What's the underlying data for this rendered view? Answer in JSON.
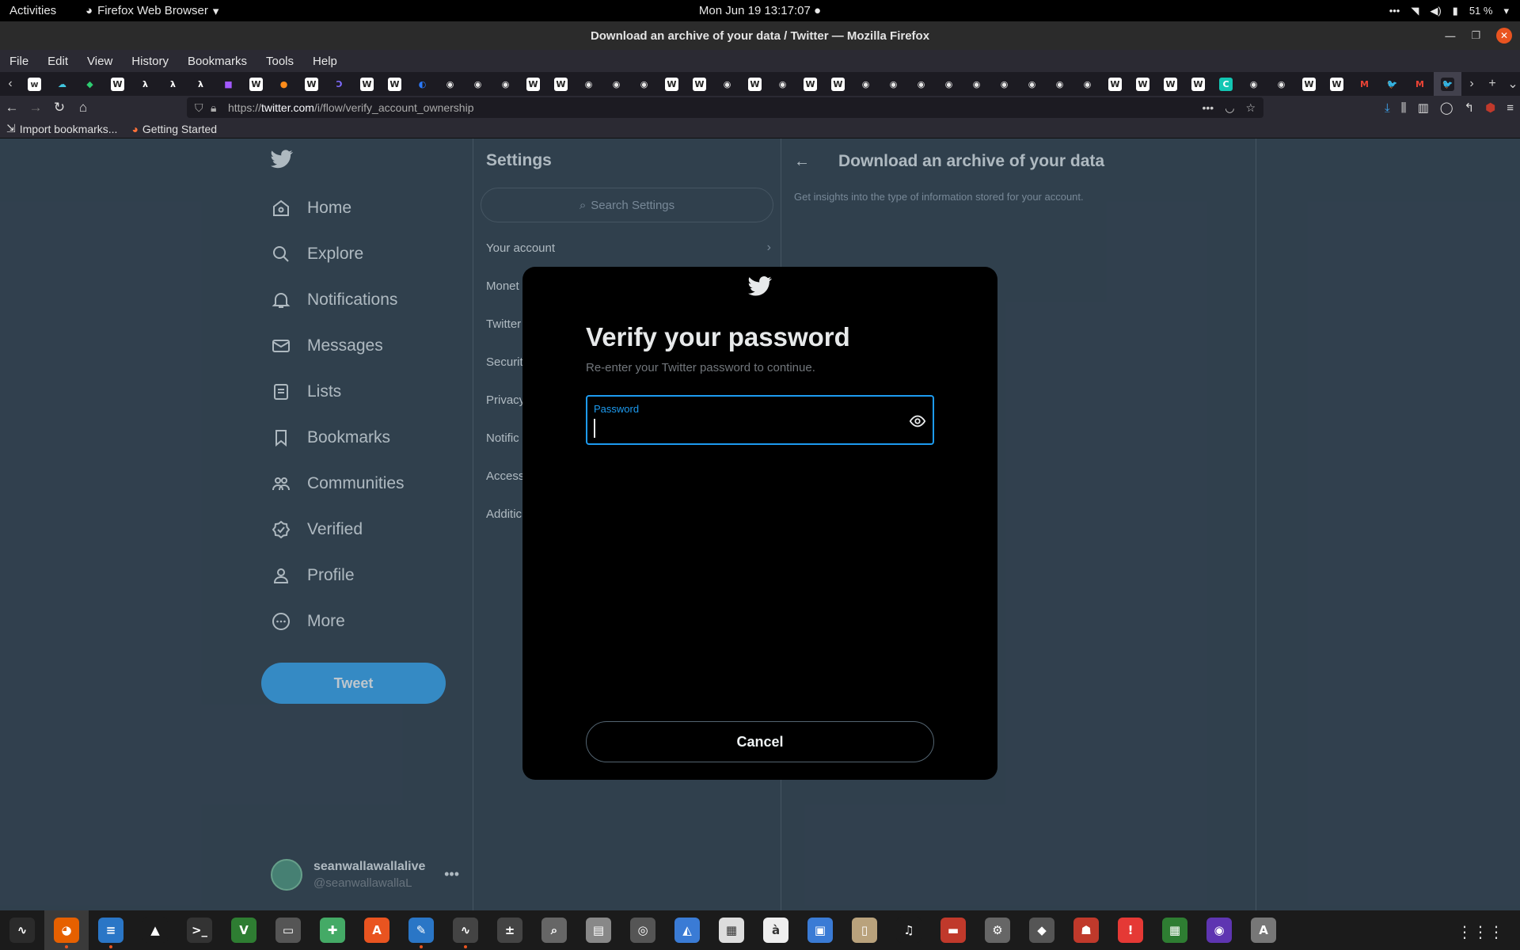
{
  "topbar": {
    "activities": "Activities",
    "app_name": "Firefox Web Browser",
    "clock": "Mon Jun 19  13:17:07",
    "battery": "51 %"
  },
  "window": {
    "title": "Download an archive of your data / Twitter — Mozilla Firefox"
  },
  "menubar": [
    "File",
    "Edit",
    "View",
    "History",
    "Bookmarks",
    "Tools",
    "Help"
  ],
  "tabs": [
    {
      "icon": "twitter-icon",
      "glyph": "w",
      "bg": "#ffffff",
      "fg": "#333"
    },
    {
      "icon": "cloud-icon",
      "glyph": "☁",
      "bg": "#1c1b22",
      "fg": "#41c7e0"
    },
    {
      "icon": "shield-icon",
      "glyph": "◆",
      "bg": "#1c1b22",
      "fg": "#2ecc71"
    },
    {
      "icon": "wikipedia-icon",
      "glyph": "W",
      "bg": "#ffffff",
      "fg": "#222"
    },
    {
      "icon": "lambda-icon",
      "glyph": "λ",
      "bg": "#1c1b22",
      "fg": "#ffffff"
    },
    {
      "icon": "lambda-icon",
      "glyph": "λ",
      "bg": "#1c1b22",
      "fg": "#ffffff"
    },
    {
      "icon": "lambda-icon",
      "glyph": "λ",
      "bg": "#1c1b22",
      "fg": "#ffffff"
    },
    {
      "icon": "folder-icon",
      "glyph": "■",
      "bg": "#1c1b22",
      "fg": "#a259ff"
    },
    {
      "icon": "wikipedia-icon",
      "glyph": "W",
      "bg": "#ffffff",
      "fg": "#222"
    },
    {
      "icon": "orange-icon",
      "glyph": "●",
      "bg": "#1c1b22",
      "fg": "#ff8c1a"
    },
    {
      "icon": "wikipedia-icon",
      "glyph": "W",
      "bg": "#ffffff",
      "fg": "#222"
    },
    {
      "icon": "curve-icon",
      "glyph": "Ↄ",
      "bg": "#1c1b22",
      "fg": "#7f6bff"
    },
    {
      "icon": "wikipedia-icon",
      "glyph": "W",
      "bg": "#ffffff",
      "fg": "#222"
    },
    {
      "icon": "wikipedia-icon",
      "glyph": "W",
      "bg": "#ffffff",
      "fg": "#222"
    },
    {
      "icon": "drop-icon",
      "glyph": "◐",
      "bg": "#1c1b22",
      "fg": "#2b7bff"
    },
    {
      "icon": "github-icon",
      "glyph": "◉",
      "bg": "#1c1b22",
      "fg": "#e8e8e8"
    },
    {
      "icon": "github-icon",
      "glyph": "◉",
      "bg": "#1c1b22",
      "fg": "#e8e8e8"
    },
    {
      "icon": "github-icon",
      "glyph": "◉",
      "bg": "#1c1b22",
      "fg": "#e8e8e8"
    },
    {
      "icon": "wikipedia-icon",
      "glyph": "W",
      "bg": "#ffffff",
      "fg": "#222"
    },
    {
      "icon": "wikipedia-icon",
      "glyph": "W",
      "bg": "#ffffff",
      "fg": "#222"
    },
    {
      "icon": "github-icon",
      "glyph": "◉",
      "bg": "#1c1b22",
      "fg": "#e8e8e8"
    },
    {
      "icon": "github-icon",
      "glyph": "◉",
      "bg": "#1c1b22",
      "fg": "#e8e8e8"
    },
    {
      "icon": "github-icon",
      "glyph": "◉",
      "bg": "#1c1b22",
      "fg": "#e8e8e8"
    },
    {
      "icon": "wikipedia-icon",
      "glyph": "W",
      "bg": "#ffffff",
      "fg": "#222"
    },
    {
      "icon": "wikipedia-icon",
      "glyph": "W",
      "bg": "#ffffff",
      "fg": "#222"
    },
    {
      "icon": "github-icon",
      "glyph": "◉",
      "bg": "#1c1b22",
      "fg": "#e8e8e8"
    },
    {
      "icon": "wikipedia-icon",
      "glyph": "W",
      "bg": "#ffffff",
      "fg": "#222"
    },
    {
      "icon": "github-icon",
      "glyph": "◉",
      "bg": "#1c1b22",
      "fg": "#e8e8e8"
    },
    {
      "icon": "wikipedia-icon",
      "glyph": "W",
      "bg": "#ffffff",
      "fg": "#222"
    },
    {
      "icon": "wikipedia-icon",
      "glyph": "W",
      "bg": "#ffffff",
      "fg": "#222"
    },
    {
      "icon": "github-icon",
      "glyph": "◉",
      "bg": "#1c1b22",
      "fg": "#e8e8e8"
    },
    {
      "icon": "github-icon",
      "glyph": "◉",
      "bg": "#1c1b22",
      "fg": "#e8e8e8"
    },
    {
      "icon": "github-icon",
      "glyph": "◉",
      "bg": "#1c1b22",
      "fg": "#e8e8e8"
    },
    {
      "icon": "github-icon",
      "glyph": "◉",
      "bg": "#1c1b22",
      "fg": "#e8e8e8"
    },
    {
      "icon": "github-icon",
      "glyph": "◉",
      "bg": "#1c1b22",
      "fg": "#e8e8e8"
    },
    {
      "icon": "github-icon",
      "glyph": "◉",
      "bg": "#1c1b22",
      "fg": "#e8e8e8"
    },
    {
      "icon": "github-icon",
      "glyph": "◉",
      "bg": "#1c1b22",
      "fg": "#e8e8e8"
    },
    {
      "icon": "github-icon",
      "glyph": "◉",
      "bg": "#1c1b22",
      "fg": "#e8e8e8"
    },
    {
      "icon": "github-icon",
      "glyph": "◉",
      "bg": "#1c1b22",
      "fg": "#e8e8e8"
    },
    {
      "icon": "wikipedia-icon",
      "glyph": "W",
      "bg": "#ffffff",
      "fg": "#222"
    },
    {
      "icon": "wikipedia-icon",
      "glyph": "W",
      "bg": "#ffffff",
      "fg": "#222"
    },
    {
      "icon": "wikipedia-icon",
      "glyph": "W",
      "bg": "#ffffff",
      "fg": "#222"
    },
    {
      "icon": "wikipedia-icon",
      "glyph": "W",
      "bg": "#ffffff",
      "fg": "#222"
    },
    {
      "icon": "c-icon",
      "glyph": "C",
      "bg": "#13c6b3",
      "fg": "#ffffff"
    },
    {
      "icon": "github-icon",
      "glyph": "◉",
      "bg": "#1c1b22",
      "fg": "#e8e8e8"
    },
    {
      "icon": "github-icon",
      "glyph": "◉",
      "bg": "#1c1b22",
      "fg": "#e8e8e8"
    },
    {
      "icon": "wikipedia-icon",
      "glyph": "W",
      "bg": "#ffffff",
      "fg": "#222"
    },
    {
      "icon": "wikipedia-icon",
      "glyph": "W",
      "bg": "#ffffff",
      "fg": "#222"
    },
    {
      "icon": "gmail-icon",
      "glyph": "M",
      "bg": "#1c1b22",
      "fg": "#ea4335"
    },
    {
      "icon": "twitter-icon",
      "glyph": "🐦",
      "bg": "#1c1b22",
      "fg": "#1d9bf0"
    },
    {
      "icon": "gmail-icon",
      "glyph": "M",
      "bg": "#1c1b22",
      "fg": "#ea4335"
    },
    {
      "icon": "twitter-icon",
      "glyph": "🐦",
      "bg": "#1c1b22",
      "fg": "#1d9bf0",
      "active": true
    }
  ],
  "urlbar": {
    "prefix": "https://",
    "host": "twitter.com",
    "path": "/i/flow/verify_account_ownership"
  },
  "bookmarks": [
    {
      "label": "Import bookmarks...",
      "icon": "import-icon"
    },
    {
      "label": "Getting Started",
      "icon": "firefox-icon"
    }
  ],
  "leftnav": {
    "items": [
      {
        "label": "Home",
        "icon": "home-icon"
      },
      {
        "label": "Explore",
        "icon": "search-icon"
      },
      {
        "label": "Notifications",
        "icon": "bell-icon"
      },
      {
        "label": "Messages",
        "icon": "envelope-icon"
      },
      {
        "label": "Lists",
        "icon": "list-icon"
      },
      {
        "label": "Bookmarks",
        "icon": "bookmark-icon"
      },
      {
        "label": "Communities",
        "icon": "people-icon"
      },
      {
        "label": "Verified",
        "icon": "verified-icon"
      },
      {
        "label": "Profile",
        "icon": "person-icon"
      },
      {
        "label": "More",
        "icon": "more-circle-icon"
      }
    ],
    "tweet_button": "Tweet",
    "account": {
      "display_name": "seanwallawallalive",
      "username": "@seanwallawallaL"
    }
  },
  "settings": {
    "title": "Settings",
    "search_placeholder": "Search Settings",
    "items": [
      "Your account",
      "Monet",
      "Twitter",
      "Securit",
      "Privacy",
      "Notific",
      "Access",
      "Additic"
    ]
  },
  "detail": {
    "title": "Download an archive of your data",
    "description": "Get insights into the type of information stored for your account."
  },
  "modal": {
    "title": "Verify your password",
    "subtitle": "Re-enter your Twitter password to continue.",
    "password_label": "Password",
    "password_value": "",
    "cancel": "Cancel"
  },
  "dock": [
    {
      "icon": "system-monitor-icon",
      "glyph": "∿",
      "bg": "#2b2b2b"
    },
    {
      "icon": "firefox-icon",
      "glyph": "◕",
      "bg": "#e66000",
      "active": true
    },
    {
      "icon": "writer-icon",
      "glyph": "≡",
      "bg": "#2a76c6"
    },
    {
      "icon": "vlc-icon",
      "glyph": "▲",
      "bg": "#1b1b1b"
    },
    {
      "icon": "terminal-icon",
      "glyph": ">_",
      "bg": "#333"
    },
    {
      "icon": "vim-icon",
      "glyph": "V",
      "bg": "#2e7d32"
    },
    {
      "icon": "display-icon",
      "glyph": "▭",
      "bg": "#555"
    },
    {
      "icon": "puzzle-icon",
      "glyph": "✚",
      "bg": "#4a6"
    },
    {
      "icon": "app-store-icon",
      "glyph": "A",
      "bg": "#e95420"
    },
    {
      "icon": "notes-icon",
      "glyph": "✎",
      "bg": "#2a76c6"
    },
    {
      "icon": "monitor-graph-icon",
      "glyph": "∿",
      "bg": "#444"
    },
    {
      "icon": "calculator-icon",
      "glyph": "±",
      "bg": "#444"
    },
    {
      "icon": "image-viewer-icon",
      "glyph": "⌕",
      "bg": "#666"
    },
    {
      "icon": "files-icon",
      "glyph": "▤",
      "bg": "#888"
    },
    {
      "icon": "disks-icon",
      "glyph": "◎",
      "bg": "#555"
    },
    {
      "icon": "scanner-icon",
      "glyph": "◭",
      "bg": "#3a7bd5"
    },
    {
      "icon": "pdf-viewer-icon",
      "glyph": "▦",
      "bg": "#ddd"
    },
    {
      "icon": "fonts-icon",
      "glyph": "à",
      "bg": "#eee"
    },
    {
      "icon": "remote-desktop-icon",
      "glyph": "▣",
      "bg": "#3a7bd5"
    },
    {
      "icon": "archive-icon",
      "glyph": "▯",
      "bg": "#b9a27c"
    },
    {
      "icon": "music-icon",
      "glyph": "♫",
      "bg": "#1b1b1b"
    },
    {
      "icon": "document-viewer-icon",
      "glyph": "▬",
      "bg": "#c0392b"
    },
    {
      "icon": "settings-icon",
      "glyph": "⚙",
      "bg": "#666"
    },
    {
      "icon": "gimp-icon",
      "glyph": "◆",
      "bg": "#555"
    },
    {
      "icon": "game-icon",
      "glyph": "☗",
      "bg": "#c0392b"
    },
    {
      "icon": "alert-icon",
      "glyph": "!",
      "bg": "#e53935"
    },
    {
      "icon": "spreadsheet-icon",
      "glyph": "▦",
      "bg": "#2e7d32"
    },
    {
      "icon": "screenshot-icon",
      "glyph": "◉",
      "bg": "#5e35b1"
    },
    {
      "icon": "software-updater-icon",
      "glyph": "A",
      "bg": "#777"
    }
  ]
}
